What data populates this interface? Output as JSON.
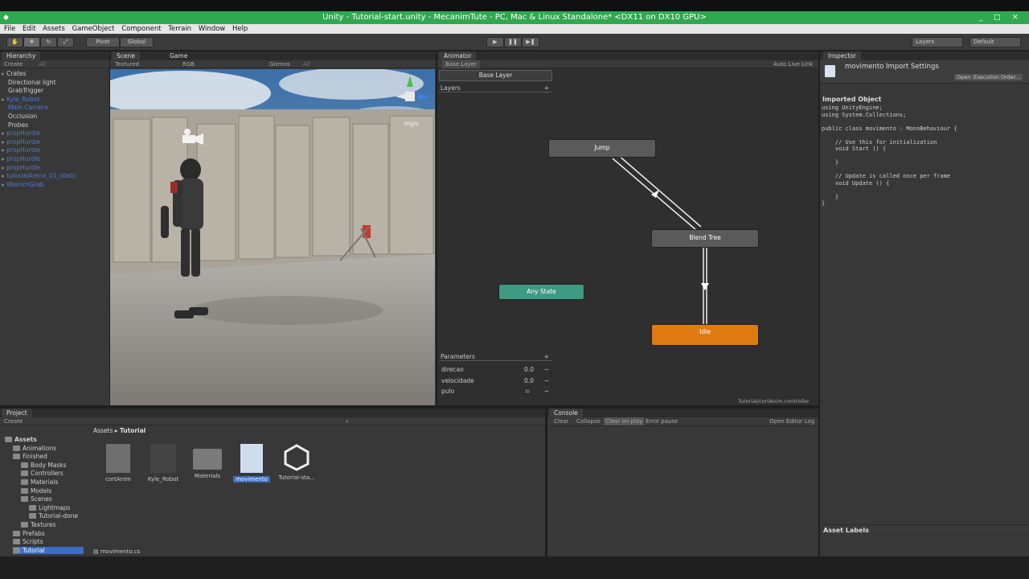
{
  "window": {
    "title": "Unity - Tutorial-start.unity - MecanimTute - PC, Mac & Linux Standalone* <DX11 on DX10 GPU>",
    "controls": [
      "_",
      "□",
      "✕"
    ]
  },
  "menu": [
    "File",
    "Edit",
    "Assets",
    "GameObject",
    "Component",
    "Terrain",
    "Window",
    "Help"
  ],
  "toolbar": {
    "pivot": "Pivot",
    "global": "Global",
    "layers": "Layers",
    "layout": "Default"
  },
  "hierarchy": {
    "tab": "Hierarchy",
    "create": "Create",
    "search": "All",
    "items": [
      {
        "label": "Crates",
        "blue": false,
        "arrow": true
      },
      {
        "label": "Directional light",
        "blue": false,
        "arrow": false
      },
      {
        "label": "GrabTrigger",
        "blue": false,
        "arrow": false
      },
      {
        "label": "Kyle_Robot",
        "blue": true,
        "arrow": true
      },
      {
        "label": "Main Camera",
        "blue": true,
        "arrow": false
      },
      {
        "label": "Occlusion",
        "blue": false,
        "arrow": false
      },
      {
        "label": "Probes",
        "blue": false,
        "arrow": false
      },
      {
        "label": "propHurdle",
        "blue": true,
        "arrow": true
      },
      {
        "label": "propHurdle",
        "blue": true,
        "arrow": true
      },
      {
        "label": "propHurdle",
        "blue": true,
        "arrow": true
      },
      {
        "label": "propHurdle",
        "blue": true,
        "arrow": true
      },
      {
        "label": "propHurdle",
        "blue": true,
        "arrow": true
      },
      {
        "label": "tutorialArena_01_static",
        "blue": true,
        "arrow": true
      },
      {
        "label": "WrenchGrab",
        "blue": true,
        "arrow": true
      }
    ]
  },
  "scene": {
    "tab_scene": "Scene",
    "tab_game": "Game",
    "shading": "Textured",
    "rgb": "RGB",
    "gizmos": "Gizmos",
    "search": "All",
    "orientation": "Right"
  },
  "animator": {
    "tab": "Animator",
    "layer_tab": "Base Layer",
    "live_link": "Auto Live Link",
    "breadcrumb": "Base Layer",
    "layers_label": "Layers",
    "states": {
      "jump": "Jump",
      "blend": "Blend Tree",
      "any": "Any State",
      "idle": "Idle"
    },
    "parameters_label": "Parameters",
    "parameters": [
      {
        "name": "direcao",
        "value": "0.0"
      },
      {
        "name": "velocidade",
        "value": "0.0"
      },
      {
        "name": "pulo",
        "value": ""
      }
    ],
    "controller_path": "Tutorial/cortAnim.controller"
  },
  "inspector": {
    "tab": "Inspector",
    "title": "movimento Import Settings",
    "open_btn": "Open...",
    "exec_btn": "Execution Order...",
    "section": "Imported Object",
    "code": "using UnityEngine;\nusing System.Collections;\n\npublic class movimento : MonoBehaviour {\n\n    // Use this for initialization\n    void Start () {\n\n    }\n\n    // Update is called once per frame\n    void Update () {\n\n    }\n}",
    "asset_labels": "Asset Labels"
  },
  "project": {
    "tab": "Project",
    "create": "Create",
    "breadcrumb_root": "Assets",
    "breadcrumb_current": "Tutorial",
    "tree": [
      {
        "label": "Assets",
        "indent": 0,
        "bold": true
      },
      {
        "label": "Animations",
        "indent": 1
      },
      {
        "label": "Finished",
        "indent": 1
      },
      {
        "label": "Body Masks",
        "indent": 2
      },
      {
        "label": "Controllers",
        "indent": 2
      },
      {
        "label": "Materials",
        "indent": 2
      },
      {
        "label": "Models",
        "indent": 2
      },
      {
        "label": "Scenes",
        "indent": 2
      },
      {
        "label": "Lightmaps",
        "indent": 3
      },
      {
        "label": "Tutorial-done",
        "indent": 3
      },
      {
        "label": "Textures",
        "indent": 2
      },
      {
        "label": "Prefabs",
        "indent": 1
      },
      {
        "label": "Scripts",
        "indent": 1
      },
      {
        "label": "Tutorial",
        "indent": 1,
        "selected": true
      }
    ],
    "assets": [
      "cortAnim",
      "Kyle_Robot",
      "Materials",
      "movimento",
      "Tutorial-sta..."
    ],
    "selected_asset": "movimento",
    "status_file": "movimento.cs"
  },
  "console": {
    "tab": "Console",
    "buttons": [
      "Clear",
      "Collapse",
      "Clear on play",
      "Error pause"
    ],
    "open_log": "Open Editor Log"
  },
  "colors": {
    "title_green": "#2fa84f",
    "any_state": "#3e9a82",
    "idle_orange": "#e07b12",
    "selected_blue": "#3d6dc4"
  }
}
